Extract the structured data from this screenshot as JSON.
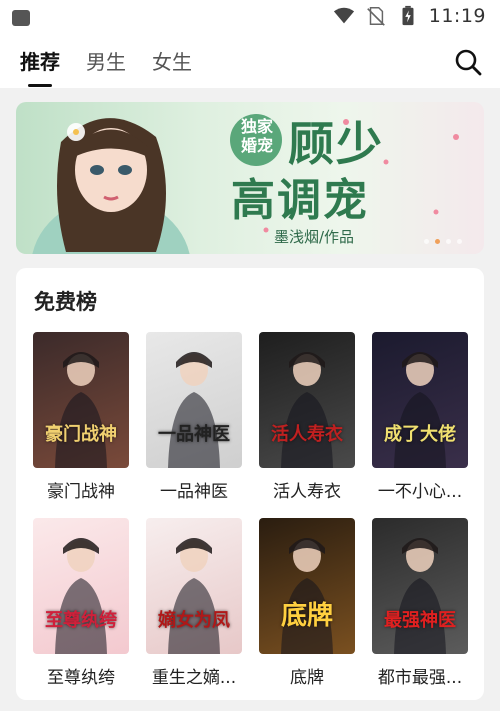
{
  "status_bar": {
    "time": "11:19"
  },
  "nav": {
    "tabs": [
      {
        "label": "推荐",
        "active": true
      },
      {
        "label": "男生",
        "active": false
      },
      {
        "label": "女生",
        "active": false
      }
    ]
  },
  "banner": {
    "tag_line1": "独家",
    "tag_line2": "婚宠",
    "title_line1": "顾少",
    "title_line2": "高调宠",
    "author": "墨浅烟/作品",
    "dot_count": 4,
    "active_dot": 1
  },
  "free_list": {
    "title": "免费榜",
    "books": [
      {
        "name": "豪门战神",
        "cover_text": "豪门战神",
        "colors": [
          "#3b2a2a",
          "#7a4a3a"
        ],
        "accent": "#f0d070"
      },
      {
        "name": "一品神医",
        "cover_text": "一品神医",
        "colors": [
          "#e8e8e8",
          "#cfcfcf"
        ],
        "accent": "#222222"
      },
      {
        "name": "活人寿衣",
        "cover_text": "活人寿衣",
        "colors": [
          "#1e1e1e",
          "#4a4a4a"
        ],
        "accent": "#c02020"
      },
      {
        "name": "一不小心...",
        "cover_text": "成了大佬",
        "colors": [
          "#1b1a2e",
          "#3a2f4a"
        ],
        "accent": "#f0e070"
      },
      {
        "name": "至尊纨绔",
        "cover_text": "至尊纨绔",
        "colors": [
          "#fbe9ea",
          "#f3c9cf"
        ],
        "accent": "#d0203a"
      },
      {
        "name": "重生之嫡...",
        "cover_text": "嫡女为凤",
        "colors": [
          "#f7eeee",
          "#e7c8c8"
        ],
        "accent": "#b01818"
      },
      {
        "name": "底牌",
        "cover_text": "底牌",
        "colors": [
          "#2a1d10",
          "#7a5020"
        ],
        "accent": "#ffd040"
      },
      {
        "name": "都市最强...",
        "cover_text": "最强神医",
        "colors": [
          "#2b2b2b",
          "#5c5c5c"
        ],
        "accent": "#e02020"
      }
    ]
  }
}
